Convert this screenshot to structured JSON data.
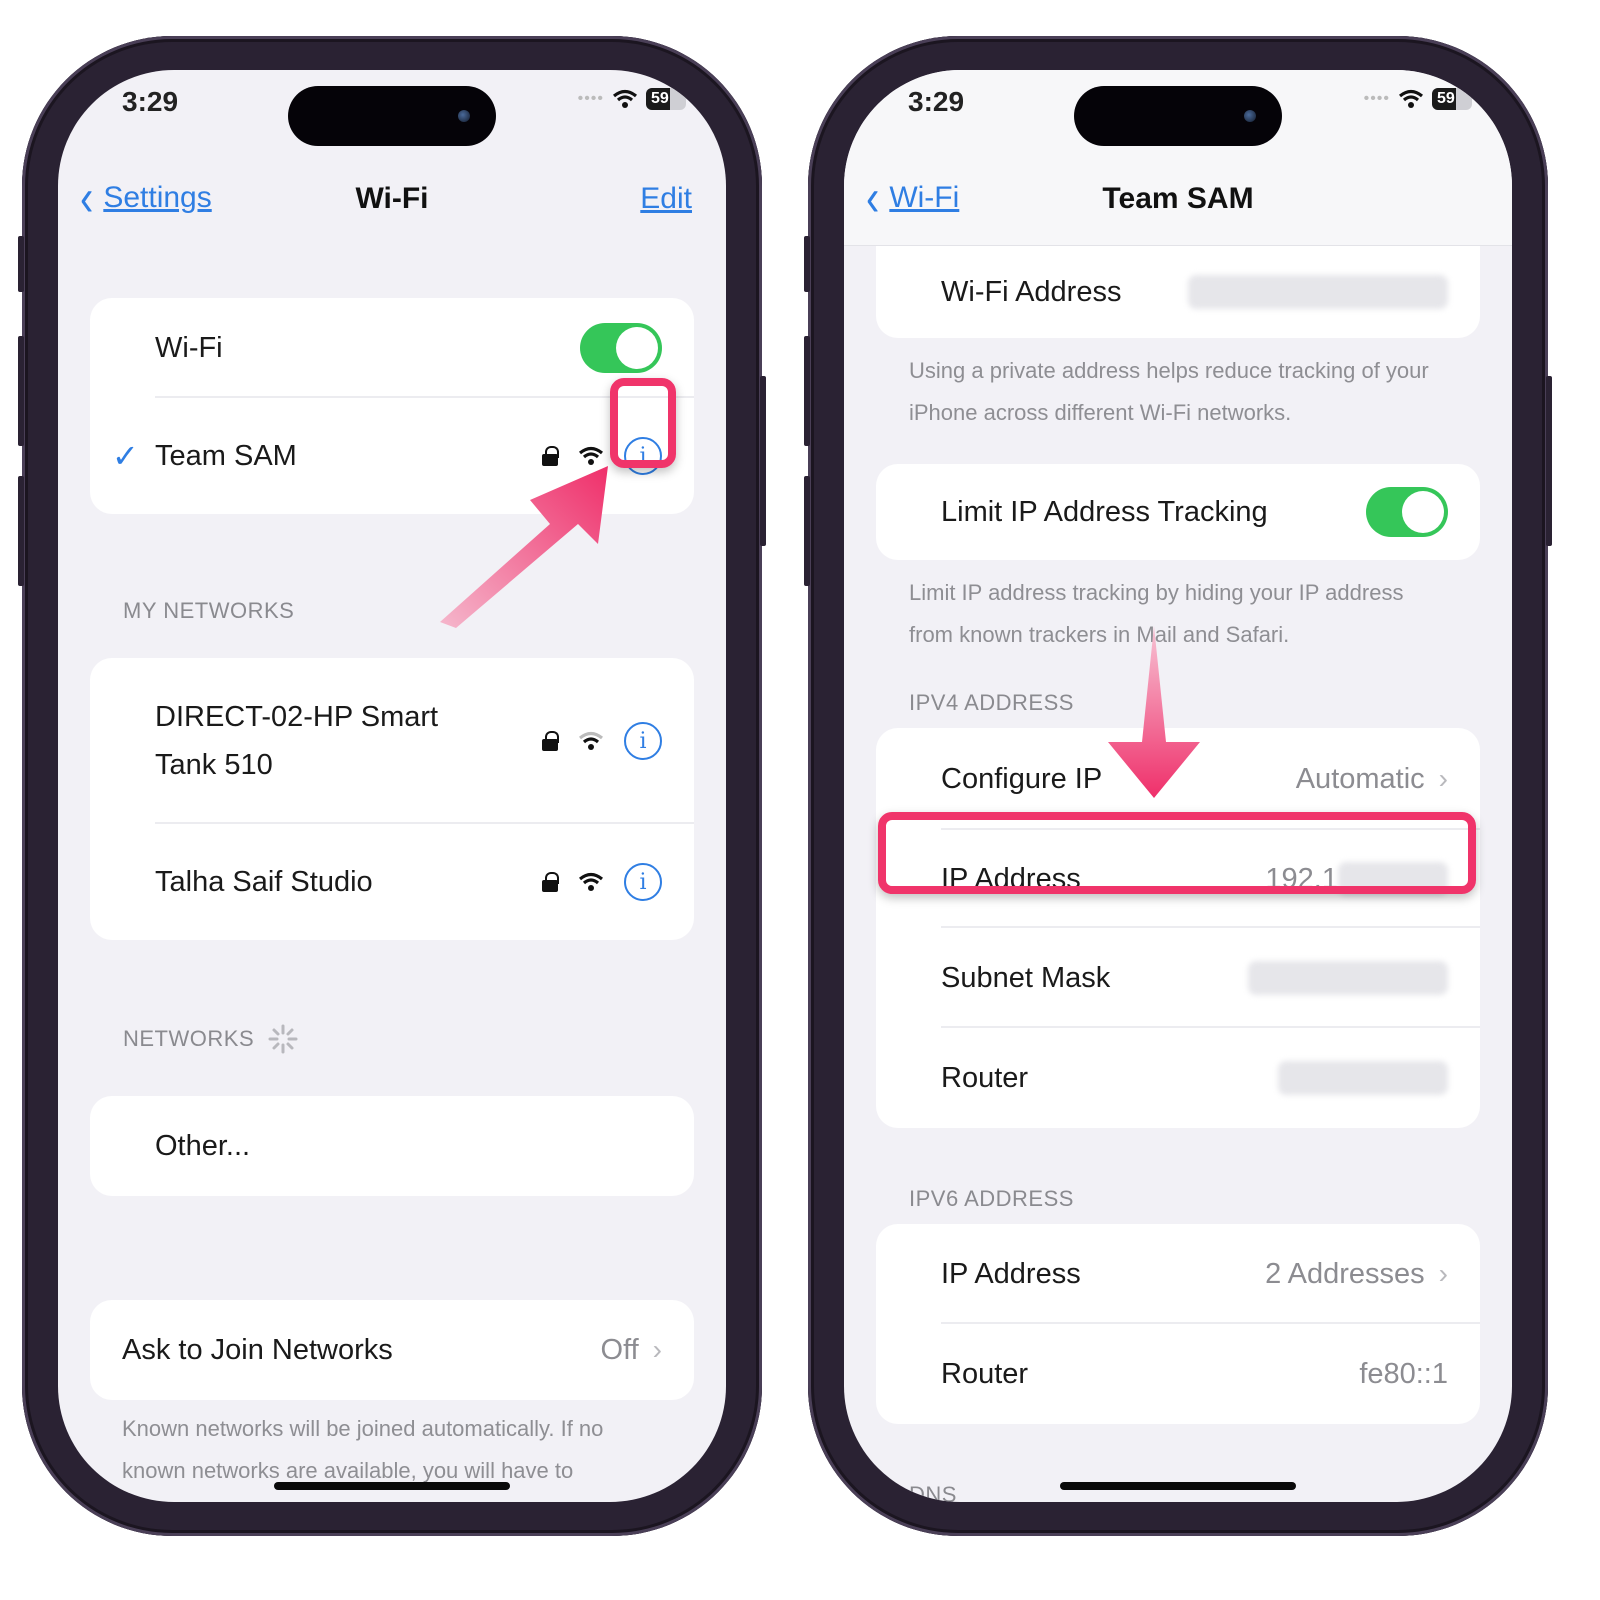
{
  "left_phone": {
    "status": {
      "time": "3:29",
      "battery": "59",
      "battery_level": 0.59
    },
    "nav": {
      "back_label": "Settings",
      "title": "Wi-Fi",
      "edit_label": "Edit"
    },
    "wifi_toggle": {
      "label": "Wi-Fi",
      "on": true
    },
    "connected_network": {
      "name": "Team SAM",
      "secured": true,
      "info_icon": "info-icon"
    },
    "my_networks": {
      "header": "MY NETWORKS",
      "items": [
        {
          "name_line1": "DIRECT-02-HP Smart",
          "name_line2": "Tank 510",
          "secured": true
        },
        {
          "name": "Talha Saif Studio",
          "secured": true
        }
      ]
    },
    "networks": {
      "header": "NETWORKS",
      "other_label": "Other..."
    },
    "ask_to_join": {
      "label": "Ask to Join Networks",
      "value": "Off"
    },
    "ask_to_join_footer": "Known networks will be joined automatically. If no known networks are available, you will have to manually select a network."
  },
  "right_phone": {
    "status": {
      "time": "3:29",
      "battery": "59",
      "battery_level": 0.59
    },
    "nav": {
      "back_label": "Wi-Fi",
      "title": "Team SAM"
    },
    "wifi_address": {
      "label": "Wi-Fi Address",
      "value_redacted": true
    },
    "wifi_address_footer": "Using a private address helps reduce tracking of your iPhone across different Wi-Fi networks.",
    "limit_ip": {
      "label": "Limit IP Address Tracking",
      "on": true
    },
    "limit_ip_footer": "Limit IP address tracking by hiding your IP address from known trackers in Mail and Safari.",
    "ipv4": {
      "header": "IPV4 ADDRESS",
      "configure_ip": {
        "label": "Configure IP",
        "value": "Automatic"
      },
      "ip_address": {
        "label": "IP Address",
        "value_visible": "192.1"
      },
      "subnet_mask": {
        "label": "Subnet Mask"
      },
      "router": {
        "label": "Router"
      }
    },
    "ipv6": {
      "header": "IPV6 ADDRESS",
      "ip_address": {
        "label": "IP Address",
        "value": "2 Addresses"
      },
      "router": {
        "label": "Router",
        "value": "fe80::1"
      }
    },
    "dns_header": "DNS"
  },
  "annotations": {
    "highlight_color": "#f0346a"
  }
}
